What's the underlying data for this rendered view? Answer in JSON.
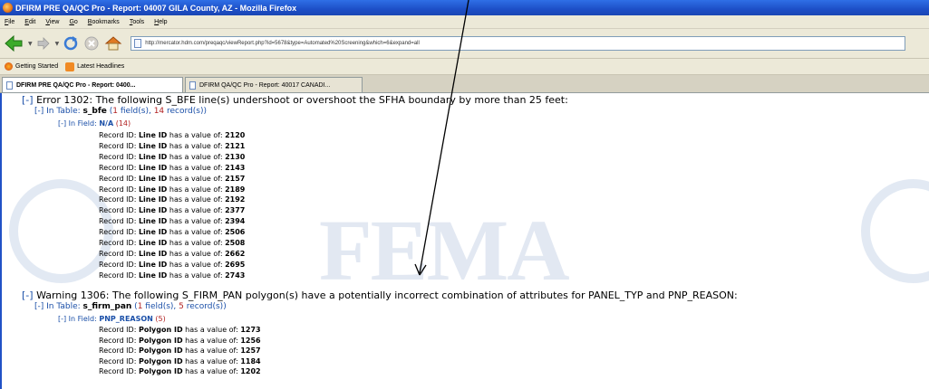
{
  "window": {
    "title": "DFIRM PRE QA/QC Pro - Report: 04007 GILA County, AZ - Mozilla Firefox"
  },
  "menu": [
    "File",
    "Edit",
    "View",
    "Go",
    "Bookmarks",
    "Tools",
    "Help"
  ],
  "nav": {
    "url": "http://mercator.hdm.com/preqaqc/viewReport.php?id=5678&type=Automated%20Screening&which=6&expand=all"
  },
  "bookmarks": [
    "Getting Started",
    "Latest Headlines"
  ],
  "tabs": [
    "DFIRM PRE QA/QC Pro - Report: 0400...",
    "DFIRM QA/QC Pro - Report: 40017 CANADI..."
  ],
  "report": {
    "error": {
      "toggle": "[-]",
      "text": "Error 1302: The following S_BFE line(s) undershoot or overshoot the SFHA boundary by more than 25 feet:",
      "table_prefix": "[-] In Table: ",
      "table": "s_bfe",
      "table_open": " (",
      "field_count": "1",
      "field_word": " field(s), ",
      "record_count": "14",
      "record_word": " record(s))",
      "field_prefix": "[-] In Field: ",
      "field": "N/A",
      "field_count_label": "(14)",
      "record_label": "Record ID: ",
      "id_name": "Line ID",
      "value_text": " has a value of: ",
      "values": [
        "2120",
        "2121",
        "2130",
        "2143",
        "2157",
        "2189",
        "2192",
        "2377",
        "2394",
        "2506",
        "2508",
        "2662",
        "2695",
        "2743"
      ]
    },
    "warning": {
      "toggle": "[-]",
      "text": "Warning 1306: The following S_FIRM_PAN polygon(s) have a potentially incorrect combination of attributes for PANEL_TYP and PNP_REASON:",
      "table_prefix": "[-] In Table: ",
      "table": "s_firm_pan",
      "table_open": " (",
      "field_count": "1",
      "field_word": " field(s), ",
      "record_count": "5",
      "record_word": " record(s))",
      "field_prefix": "[-] In Field: ",
      "field": "PNP_REASON",
      "field_count_label": "(5)",
      "record_label": "Record ID: ",
      "id_name": "Polygon ID",
      "value_text": " has a value of: ",
      "values": [
        "1273",
        "1256",
        "1257",
        "1184",
        "1202"
      ]
    }
  },
  "watermark": {
    "logo": "FEMA"
  },
  "colors": {
    "titlebar": "#1d4fc7",
    "link": "#1a4fa8",
    "count": "#b22222",
    "chrome": "#ece9d8"
  }
}
